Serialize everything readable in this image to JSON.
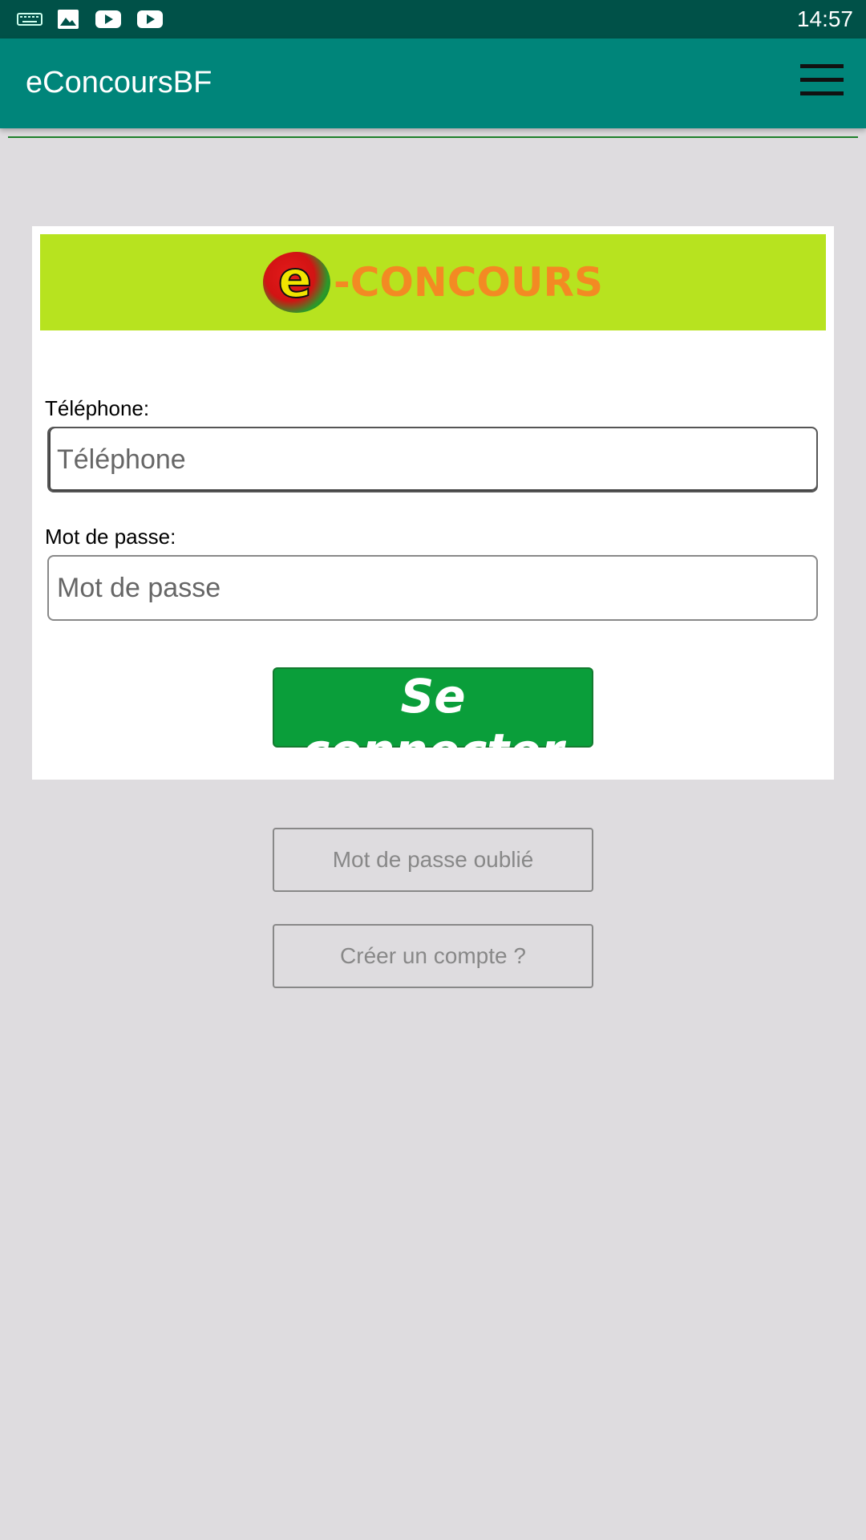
{
  "status_bar": {
    "time": "14:57",
    "icons": [
      "keyboard-icon",
      "image-icon",
      "youtube-icon",
      "youtube-icon"
    ]
  },
  "app_bar": {
    "title": "eConcoursBF",
    "menu_icon": "hamburger-menu-icon",
    "color": "#00857a"
  },
  "banner": {
    "logo_letter": "e",
    "logo_text": "-CONCOURS",
    "background": "#b7e31f",
    "text_color": "#f38a23"
  },
  "form": {
    "phone_label": "Téléphone:",
    "phone_placeholder": "Téléphone",
    "password_label": "Mot de passe:",
    "password_placeholder": "Mot de passe",
    "submit_label": "Se connecter",
    "submit_color": "#0a9e3a"
  },
  "links": {
    "forgot_password": "Mot de passe oublié",
    "create_account": "Créer un compte ?"
  }
}
